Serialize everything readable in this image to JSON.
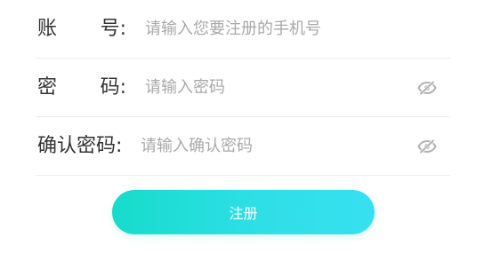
{
  "form": {
    "account": {
      "label_first": "账",
      "label_last": "号:",
      "placeholder": "请输入您要注册的手机号",
      "value": ""
    },
    "password": {
      "label_first": "密",
      "label_last": "码:",
      "placeholder": "请输入密码",
      "value": "",
      "toggle_icon": "eye-slash-icon"
    },
    "confirm_password": {
      "label": "确认密码:",
      "placeholder": "请输入确认密码",
      "value": "",
      "toggle_icon": "eye-slash-icon"
    },
    "submit_label": "注册"
  },
  "colors": {
    "label": "#333333",
    "placeholder": "#a9a9a9",
    "divider": "#ececec",
    "button_gradient_start": "#16dccb",
    "button_gradient_end": "#37e0f0",
    "icon": "#b3b3b3"
  }
}
